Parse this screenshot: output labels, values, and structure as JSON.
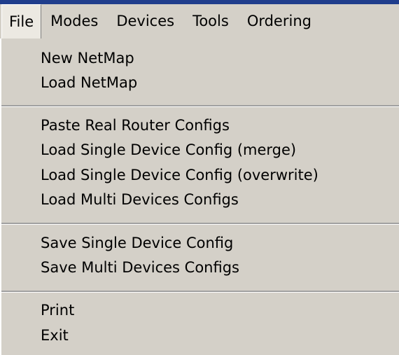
{
  "menubar": {
    "items": [
      {
        "label": "File"
      },
      {
        "label": "Modes"
      },
      {
        "label": "Devices"
      },
      {
        "label": "Tools"
      },
      {
        "label": "Ordering"
      }
    ]
  },
  "file_menu": {
    "groups": [
      [
        "New NetMap",
        "Load NetMap"
      ],
      [
        "Paste Real Router Configs",
        "Load Single Device Config (merge)",
        "Load Single Device Config (overwrite)",
        "Load Multi Devices Configs"
      ],
      [
        "Save Single Device Config",
        "Save Multi Devices Configs"
      ],
      [
        "Print",
        "Exit"
      ]
    ]
  }
}
